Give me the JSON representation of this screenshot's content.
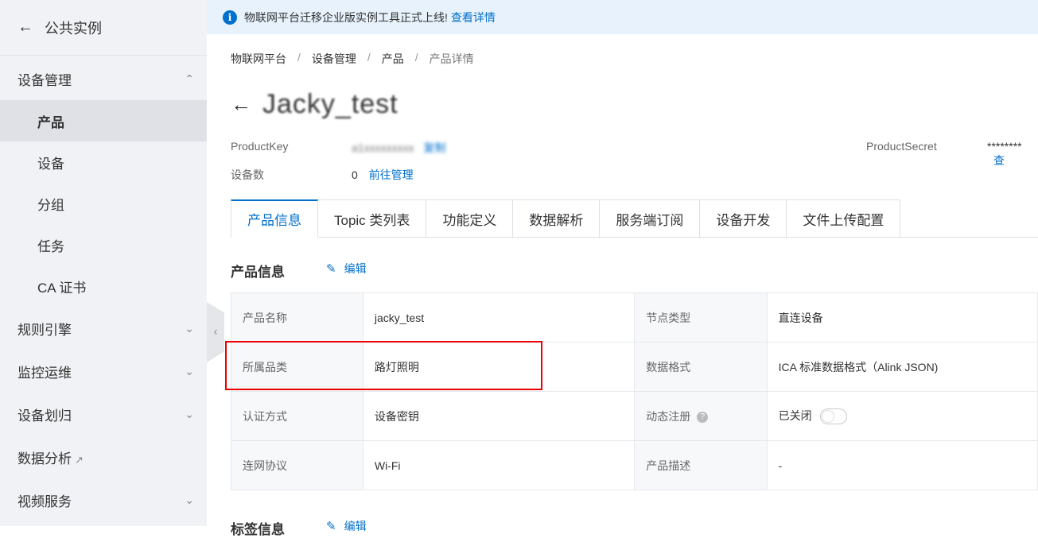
{
  "sidebar": {
    "back_label": "公共实例",
    "groups": [
      {
        "label": "设备管理",
        "expanded": true,
        "items": [
          "产品",
          "设备",
          "分组",
          "任务",
          "CA 证书"
        ]
      },
      {
        "label": "规则引擎"
      },
      {
        "label": "监控运维"
      },
      {
        "label": "设备划归"
      },
      {
        "label": "数据分析"
      },
      {
        "label": "视频服务"
      }
    ],
    "active_item": "产品"
  },
  "notice": {
    "text": "物联网平台迁移企业版实例工具正式上线!",
    "link": "查看详情"
  },
  "breadcrumb": [
    "物联网平台",
    "设备管理",
    "产品",
    "产品详情"
  ],
  "product": {
    "title": "Jacky_test",
    "product_key_label": "ProductKey",
    "product_key_value": "a1xxxxxxxxx",
    "copy_label": "复制",
    "secret_label": "ProductSecret",
    "secret_value": "********",
    "secret_view": "查",
    "device_count_label": "设备数",
    "device_count": "0",
    "manage_link": "前往管理"
  },
  "tabs": [
    "产品信息",
    "Topic 类列表",
    "功能定义",
    "数据解析",
    "服务端订阅",
    "设备开发",
    "文件上传配置"
  ],
  "active_tab": "产品信息",
  "section": {
    "title": "产品信息",
    "edit_label": "编辑"
  },
  "info": [
    {
      "k1": "产品名称",
      "v1": "jacky_test",
      "k2": "节点类型",
      "v2": "直连设备"
    },
    {
      "k1": "所属品类",
      "v1": "路灯照明",
      "k2": "数据格式",
      "v2": "ICA 标准数据格式（Alink JSON)"
    },
    {
      "k1": "认证方式",
      "v1": "设备密钥",
      "k2": "动态注册",
      "v2": "已关闭"
    },
    {
      "k1": "连网协议",
      "v1": "Wi-Fi",
      "k2": "产品描述",
      "v2": "-"
    }
  ],
  "next_section_title": "标签信息",
  "next_section_edit": "编辑"
}
